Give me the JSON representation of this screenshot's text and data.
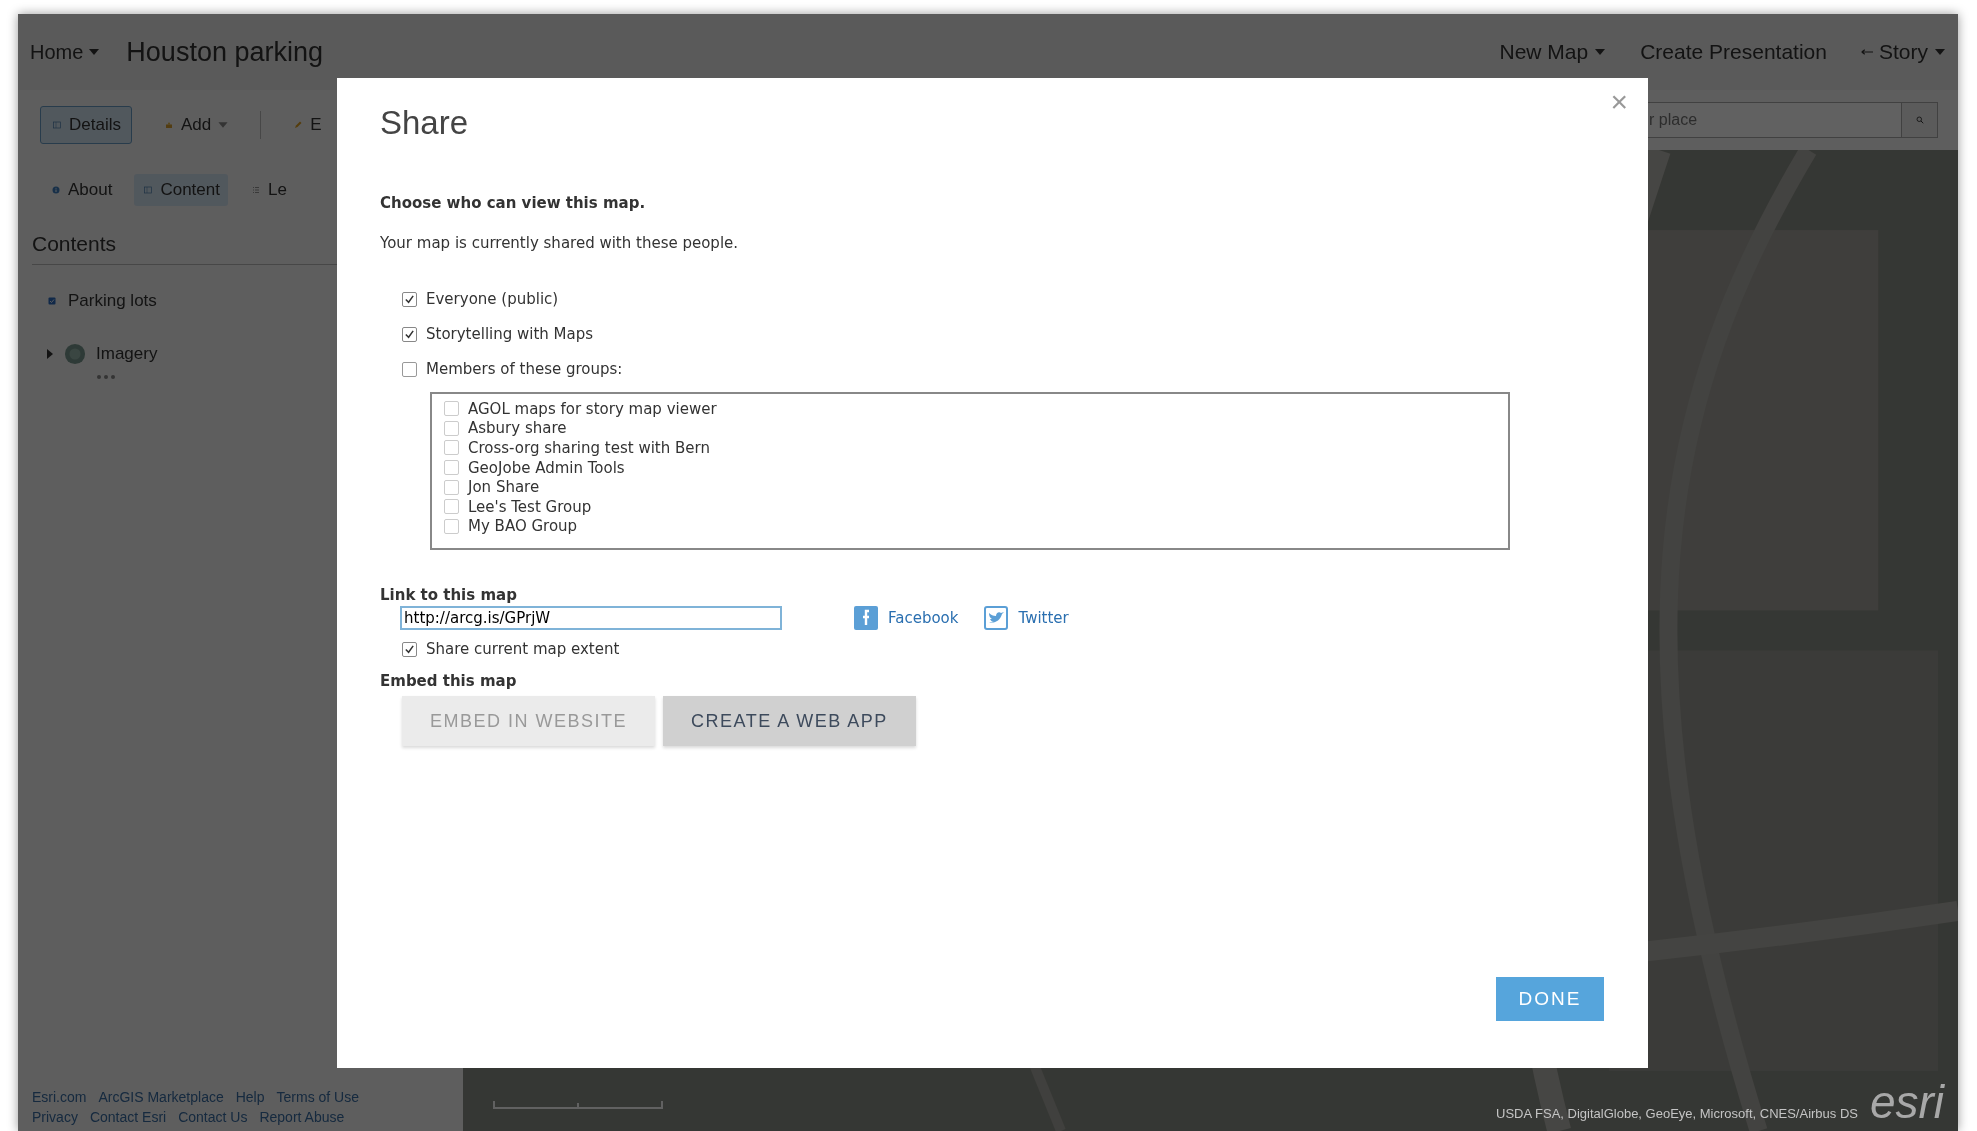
{
  "top_bar": {
    "home_menu": "Home",
    "title": "Houston parking",
    "menus": [
      {
        "label": "New Map",
        "kind": "dropdown"
      },
      {
        "label": "Create Presentation",
        "kind": "plain"
      },
      {
        "label": "Story",
        "kind": "back-dropdown"
      }
    ]
  },
  "toolbar": {
    "buttons": [
      {
        "label": "Details",
        "kind": "details",
        "selected": true
      },
      {
        "label": "Add",
        "kind": "add",
        "selected": false
      },
      {
        "label": "E",
        "kind": "edit",
        "selected": false
      }
    ]
  },
  "search": {
    "placeholder": "r place"
  },
  "tabs": [
    {
      "label": "About",
      "kind": "about",
      "selected": false
    },
    {
      "label": "Content",
      "kind": "content",
      "selected": true
    },
    {
      "label": "Le",
      "kind": "legend",
      "selected": false
    }
  ],
  "sidebar": {
    "heading": "Contents",
    "layers": [
      {
        "name": "Parking lots",
        "kind": "checkbox",
        "checked": true
      },
      {
        "name": "Imagery",
        "kind": "basemap",
        "expanded": false
      }
    ]
  },
  "footer_links": [
    [
      "Esri.com",
      "ArcGIS Marketplace",
      "Help",
      "Terms of Use"
    ],
    [
      "Privacy",
      "Contact Esri",
      "Contact Us",
      "Report Abuse"
    ]
  ],
  "map": {
    "kind": "picture",
    "attribution": "USDA FSA, DigitalGlobe, GeoEye, Microsoft, CNES/Airbus DS",
    "logo": "esri"
  },
  "dialog": {
    "title": "Share",
    "close": "×",
    "heading": "Choose who can view this map.",
    "subtext": "Your map is currently shared with these people.",
    "options": [
      {
        "label": "Everyone (public)",
        "checked": true
      },
      {
        "label": "Storytelling with Maps",
        "checked": true
      },
      {
        "label": "Members of these groups:",
        "checked": false
      }
    ],
    "groups": [
      {
        "label": "AGOL maps for story map viewer",
        "checked": false
      },
      {
        "label": "Asbury share",
        "checked": false
      },
      {
        "label": "Cross-org sharing test with Bern",
        "checked": false
      },
      {
        "label": "GeoJobe Admin Tools",
        "checked": false
      },
      {
        "label": "Jon Share",
        "checked": false
      },
      {
        "label": "Lee's Test Group",
        "checked": false
      },
      {
        "label": "My BAO Group",
        "checked": false
      }
    ],
    "link_label": "Link to this map",
    "link_value": "http://arcg.is/GPrjW",
    "social": [
      {
        "label": "Facebook",
        "kind": "facebook"
      },
      {
        "label": "Twitter",
        "kind": "twitter"
      }
    ],
    "extent": {
      "label": "Share current map extent",
      "checked": true
    },
    "embed_label": "Embed this map",
    "embed_buttons": [
      {
        "label": "EMBED IN WEBSITE",
        "disabled": true
      },
      {
        "label": "CREATE A WEB APP",
        "disabled": false
      }
    ],
    "done": "DONE"
  }
}
